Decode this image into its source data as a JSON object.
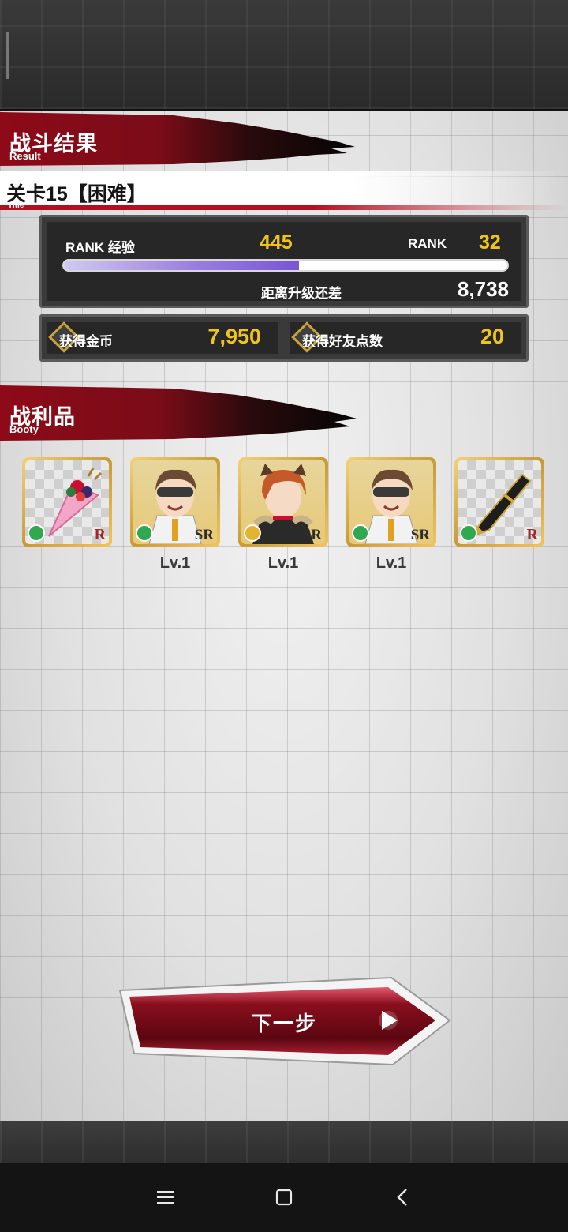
{
  "result_header": {
    "title": "战斗结果",
    "subtitle": "Result"
  },
  "stage": {
    "title": "关卡15【困难】",
    "subtitle": "Title"
  },
  "rank_panel": {
    "exp_label": "RANK 经验",
    "exp_value": "445",
    "rank_label": "RANK",
    "rank_value": "32",
    "exp_progress": 0.53,
    "remaining_label": "距离升级还差",
    "remaining_value": "8,738"
  },
  "rewards": {
    "coin_label": "获得金币",
    "coin_value": "7,950",
    "friend_label": "获得好友点数",
    "friend_value": "20"
  },
  "booty_header": {
    "title": "战利品",
    "subtitle": "Booty"
  },
  "booty": [
    {
      "name": "crepe-item",
      "rarity": "R",
      "level": ""
    },
    {
      "name": "character-goggles",
      "rarity": "SR",
      "level": "Lv.1"
    },
    {
      "name": "character-redhair",
      "rarity": "SR",
      "level": "Lv.1"
    },
    {
      "name": "character-goggles",
      "rarity": "SR",
      "level": "Lv.1"
    },
    {
      "name": "pen-item",
      "rarity": "R",
      "level": ""
    }
  ],
  "next_button": {
    "label": "下一步"
  },
  "colors": {
    "accent_red": "#b01020",
    "gold": "#f0c419",
    "exp_bar": "#7a55d6"
  },
  "navbar": {
    "icons": [
      "menu-icon",
      "home-icon",
      "back-icon"
    ]
  }
}
